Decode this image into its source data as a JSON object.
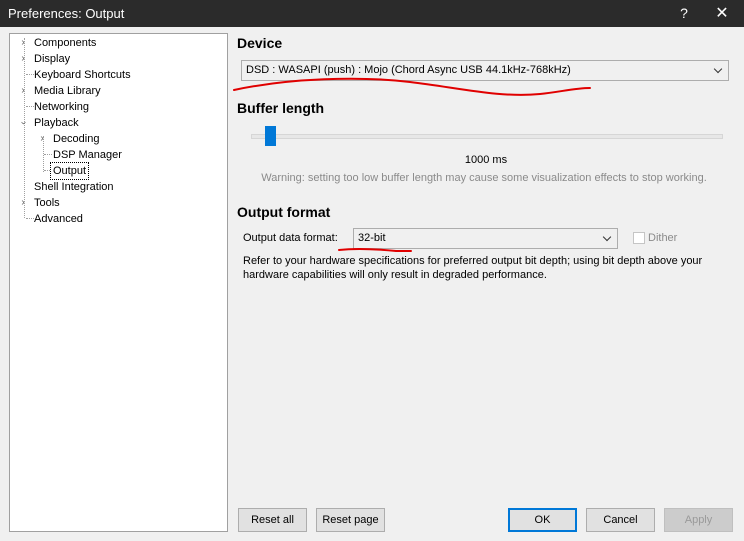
{
  "window": {
    "title": "Preferences: Output",
    "help_glyph": "?",
    "close_glyph": "✕"
  },
  "tree": {
    "items": [
      {
        "label": "Components",
        "has_arrow": true,
        "expanded": false
      },
      {
        "label": "Display",
        "has_arrow": true,
        "expanded": false
      },
      {
        "label": "Keyboard Shortcuts",
        "has_arrow": false
      },
      {
        "label": "Media Library",
        "has_arrow": true,
        "expanded": false
      },
      {
        "label": "Networking",
        "has_arrow": false
      },
      {
        "label": "Playback",
        "has_arrow": true,
        "expanded": true
      },
      {
        "label": "Decoding",
        "has_arrow": true,
        "expanded": false
      },
      {
        "label": "DSP Manager",
        "has_arrow": false
      },
      {
        "label": "Output",
        "has_arrow": false,
        "selected": true
      },
      {
        "label": "Shell Integration",
        "has_arrow": false
      },
      {
        "label": "Tools",
        "has_arrow": true,
        "expanded": false
      },
      {
        "label": "Advanced",
        "has_arrow": false
      }
    ]
  },
  "device": {
    "title": "Device",
    "selected": "DSD : WASAPI (push) : Mojo (Chord Async USB 44.1kHz-768kHz)"
  },
  "buffer": {
    "title": "Buffer length",
    "value_label": "1000 ms",
    "value_ms": 1000,
    "warning": "Warning: setting too low buffer length may cause some visualization effects to stop working."
  },
  "output_format": {
    "title": "Output format",
    "data_format_label": "Output data format:",
    "data_format_value": "32-bit",
    "dither_label": "Dither",
    "dither_checked": false,
    "info": "Refer to your hardware specifications for preferred output bit depth; using bit depth above your hardware capabilities will only result in degraded performance."
  },
  "buttons": {
    "reset_all": "Reset all",
    "reset_page": "Reset page",
    "ok": "OK",
    "cancel": "Cancel",
    "apply": "Apply"
  },
  "colors": {
    "accent": "#0078d7",
    "annotation": "#e00000",
    "titlebar": "#2b2b2b"
  }
}
